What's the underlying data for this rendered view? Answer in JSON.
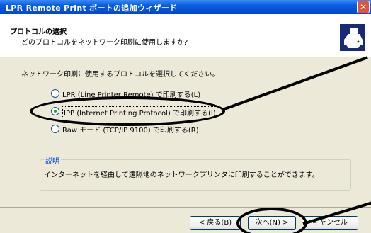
{
  "window": {
    "title": "LPR Remote Print ポートの追加ウィザード",
    "close_glyph": "✕"
  },
  "header": {
    "title": "プロトコルの選択",
    "subtitle": "どのプロトコルをネットワーク印刷に使用しますか?",
    "icon": "printer-wizard-icon"
  },
  "main": {
    "instruction": "ネットワーク印刷に使用するプロトコルを選択してください。",
    "options": [
      {
        "label": "LPR (Line Printer Remote) で印刷する(L)",
        "selected": false
      },
      {
        "label": "IPP (Internet Printing Protocol) で印刷する(I)",
        "selected": true
      },
      {
        "label": "Raw モード (TCP/IP 9100) で印刷する(R)",
        "selected": false
      }
    ],
    "description_legend": "説明",
    "description_text": "インターネットを経由して遠隔地のネットワークプリンタに印刷することができます。"
  },
  "buttons": {
    "back": "< 戻る(B)",
    "next": "次へ(N) >",
    "cancel": "キャンセル"
  },
  "colors": {
    "titlebar": "#0A5FE0",
    "dialog_bg": "#ECE9D8",
    "radio_dot": "#21A121",
    "legend": "#0046D5"
  }
}
